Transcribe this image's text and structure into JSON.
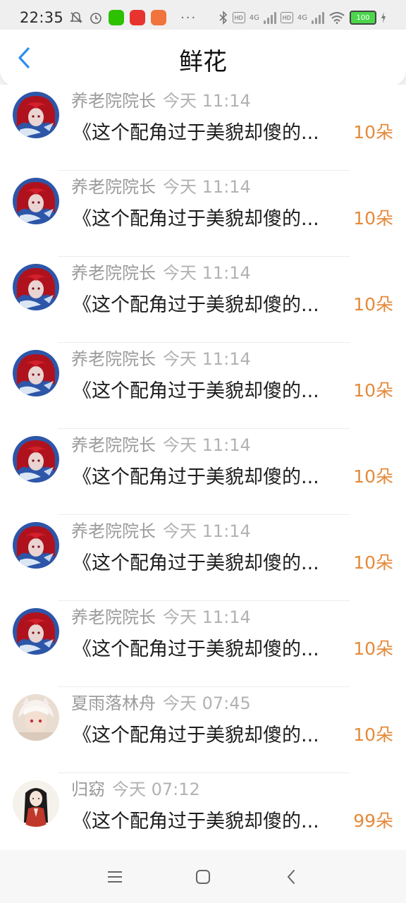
{
  "status_bar": {
    "time": "22:35",
    "more": "···",
    "hd_label": "HD",
    "net_label": "4G",
    "battery": "100"
  },
  "header": {
    "title": "鲜花"
  },
  "colors": {
    "accent": "#2a8ff0",
    "count": "#e58a3a"
  },
  "items": [
    {
      "name": "养老院院长",
      "time": "今天 11:14",
      "message": "《这个配角过于美貌却傻的...",
      "count": "10朵",
      "avatar": "red-hair-girl"
    },
    {
      "name": "养老院院长",
      "time": "今天 11:14",
      "message": "《这个配角过于美貌却傻的...",
      "count": "10朵",
      "avatar": "red-hair-girl"
    },
    {
      "name": "养老院院长",
      "time": "今天 11:14",
      "message": "《这个配角过于美貌却傻的...",
      "count": "10朵",
      "avatar": "red-hair-girl"
    },
    {
      "name": "养老院院长",
      "time": "今天 11:14",
      "message": "《这个配角过于美貌却傻的...",
      "count": "10朵",
      "avatar": "red-hair-girl"
    },
    {
      "name": "养老院院长",
      "time": "今天 11:14",
      "message": "《这个配角过于美貌却傻的...",
      "count": "10朵",
      "avatar": "red-hair-girl"
    },
    {
      "name": "养老院院长",
      "time": "今天 11:14",
      "message": "《这个配角过于美貌却傻的...",
      "count": "10朵",
      "avatar": "red-hair-girl"
    },
    {
      "name": "养老院院长",
      "time": "今天 11:14",
      "message": "《这个配角过于美貌却傻的...",
      "count": "10朵",
      "avatar": "red-hair-girl"
    },
    {
      "name": "夏雨落林舟",
      "time": "今天 07:45",
      "message": "《这个配角过于美貌却傻的...",
      "count": "10朵",
      "avatar": "white-hair-boy"
    },
    {
      "name": "归窈",
      "time": "今天 07:12",
      "message": "《这个配角过于美貌却傻的...",
      "count": "99朵",
      "avatar": "black-hair-girl"
    }
  ],
  "icons": {
    "back": "chevron-left-icon",
    "menu": "menu-icon",
    "home": "home-square-icon",
    "back_nav": "back-chevron-icon"
  }
}
